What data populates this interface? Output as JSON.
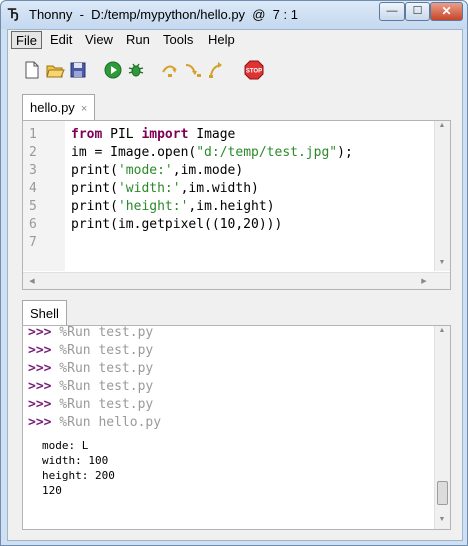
{
  "window": {
    "app_name": "Thonny",
    "title": "Thonny  -  D:/temp/mypython/hello.py  @  7 : 1",
    "minimize_glyph": "—",
    "maximize_glyph": "☐",
    "close_glyph": "✕"
  },
  "menu": {
    "items": [
      "File",
      "Edit",
      "View",
      "Run",
      "Tools",
      "Help"
    ],
    "active_index": 0
  },
  "toolbar": {
    "icons": [
      "new-file-icon",
      "open-file-icon",
      "save-file-icon",
      "run-icon",
      "debug-icon",
      "step-over-icon",
      "step-into-icon",
      "step-out-icon",
      "stop-icon"
    ],
    "stop_label": "STOP"
  },
  "editor": {
    "tab_label": "hello.py",
    "tab_close": "×",
    "line_numbers": [
      "1",
      "2",
      "3",
      "4",
      "5",
      "6",
      "7"
    ],
    "lines": [
      [
        {
          "t": "from",
          "k": "kw"
        },
        {
          "t": " PIL ",
          "k": ""
        },
        {
          "t": "import",
          "k": "kw"
        },
        {
          "t": " Image",
          "k": ""
        }
      ],
      [
        {
          "t": "im = Image.open(",
          "k": ""
        },
        {
          "t": "\"d:/temp/test.jpg\"",
          "k": "str"
        },
        {
          "t": ");",
          "k": ""
        }
      ],
      [
        {
          "t": "print(",
          "k": ""
        },
        {
          "t": "'mode:'",
          "k": "str"
        },
        {
          "t": ",im.mode)",
          "k": ""
        }
      ],
      [
        {
          "t": "print(",
          "k": ""
        },
        {
          "t": "'width:'",
          "k": "str"
        },
        {
          "t": ",im.width)",
          "k": ""
        }
      ],
      [
        {
          "t": "print(",
          "k": ""
        },
        {
          "t": "'height:'",
          "k": "str"
        },
        {
          "t": ",im.height)",
          "k": ""
        }
      ],
      [
        {
          "t": "print(im.getpixel((10,20)))",
          "k": ""
        }
      ],
      []
    ]
  },
  "shell": {
    "tab_label": "Shell",
    "prompt": ">>>",
    "history": [
      "%Run test.py",
      "%Run test.py",
      "%Run test.py",
      "%Run test.py",
      "%Run test.py",
      "%Run hello.py"
    ],
    "output": [
      "mode: L",
      "width: 100",
      "height: 200",
      "120"
    ]
  },
  "colors": {
    "keyword": "#7f0055",
    "string": "#2a8a2a",
    "prompt": "#7a1f7a",
    "history_command": "#9a9a9a"
  }
}
